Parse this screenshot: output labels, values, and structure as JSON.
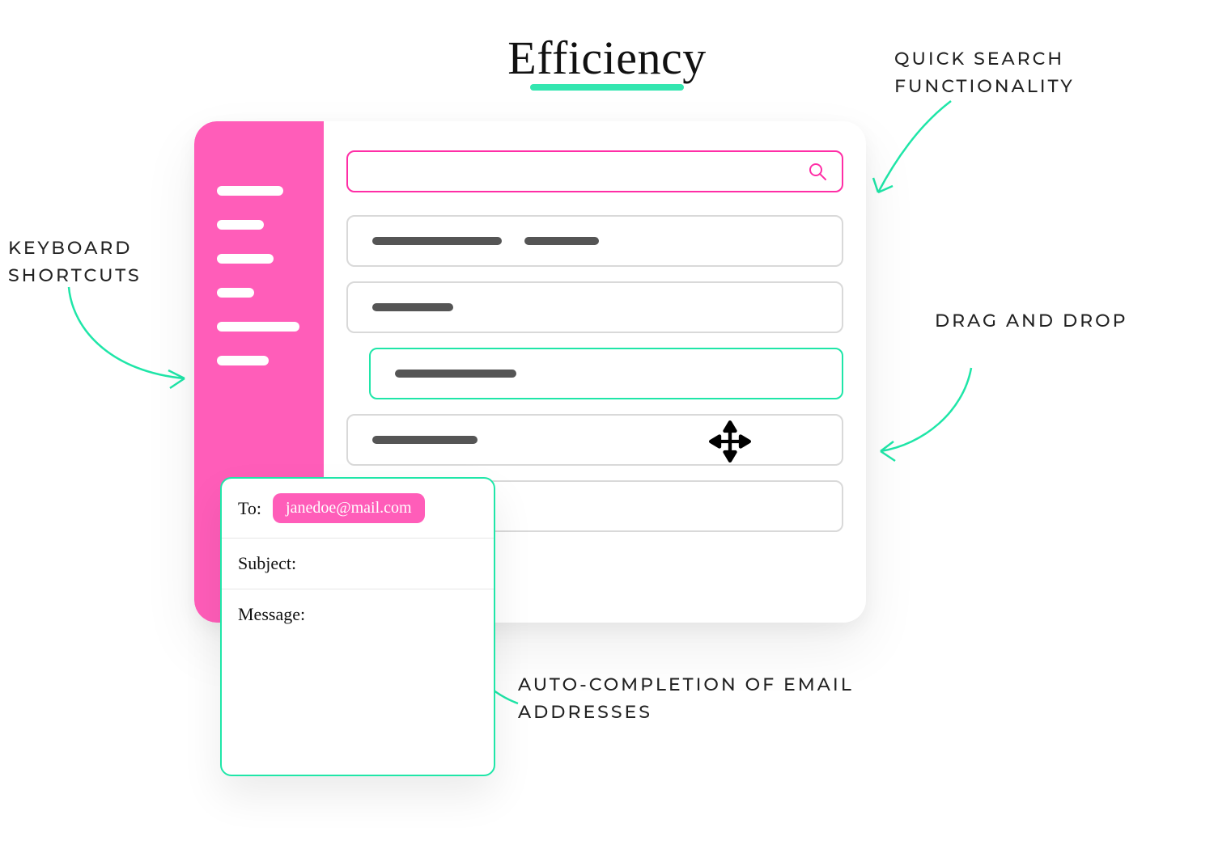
{
  "title": "Efficiency",
  "annotations": {
    "search": "QUICK SEARCH FUNCTIONALITY",
    "keyboard": "KEYBOARD SHORTCUTS",
    "drag": "DRAG AND DROP",
    "autocomplete": "AUTO-COMPLETION OF EMAIL ADDRESSES"
  },
  "compose": {
    "to_label": "To:",
    "to_chip": "janedoe@mail.com",
    "subject_label": "Subject:",
    "message_label": "Message:"
  },
  "colors": {
    "accent_pink": "#FF5DB9",
    "accent_pink_bold": "#FF2EA6",
    "accent_green": "#1fe6a8"
  }
}
